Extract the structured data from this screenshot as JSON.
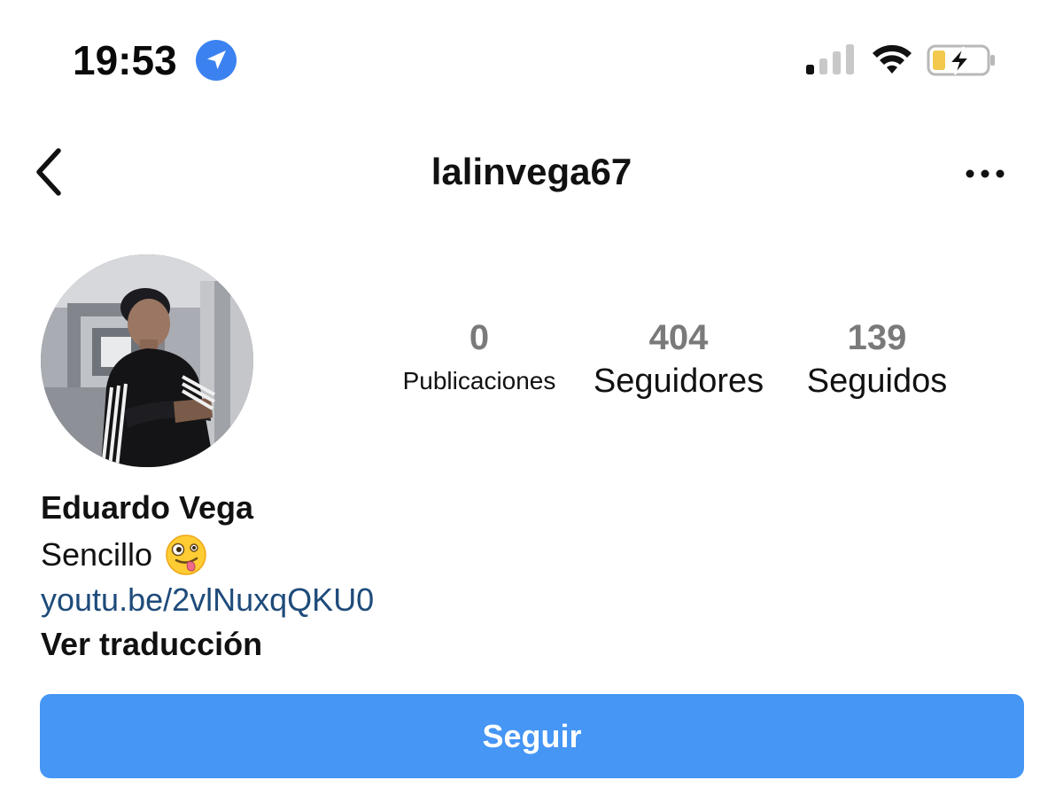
{
  "status_bar": {
    "time": "19:53",
    "icons": [
      "location-arrow-icon",
      "cellular-signal-icon",
      "wifi-icon",
      "battery-charging-icon"
    ]
  },
  "header": {
    "username": "lalinvega67",
    "back_icon": "chevron-left-icon",
    "more_icon": "more-horizontal-icon"
  },
  "profile": {
    "stats": {
      "posts": {
        "count": "0",
        "label": "Publicaciones"
      },
      "followers": {
        "count": "404",
        "label": "Seguidores"
      },
      "following": {
        "count": "139",
        "label": "Seguidos"
      }
    },
    "bio": {
      "name": "Eduardo Vega",
      "text": "Sencillo",
      "emoji": "zany-face-emoji",
      "link": "youtu.be/2vlNuxqQKU0",
      "translate_label": "Ver traducción"
    }
  },
  "actions": {
    "follow_label": "Seguir"
  },
  "colors": {
    "follow_button": "#4596f5",
    "link": "#1e4b7a",
    "location_badge": "#3b82f0",
    "stat_count": "#7a7a7a",
    "battery_fill": "#f2c94c"
  }
}
